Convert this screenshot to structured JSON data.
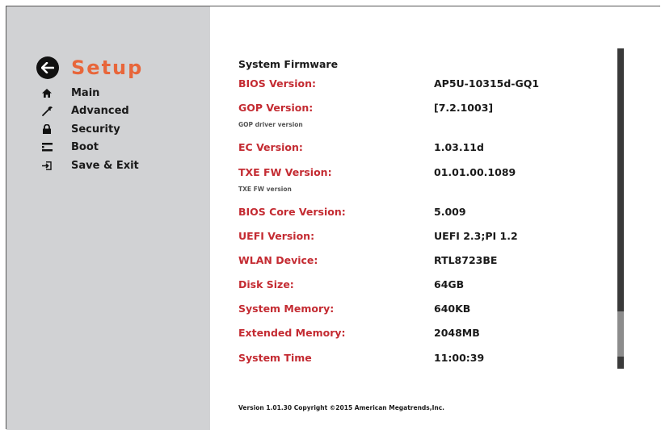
{
  "header": {
    "title": "Setup"
  },
  "nav": [
    {
      "label": "Main",
      "icon": "home-icon"
    },
    {
      "label": "Advanced",
      "icon": "wrench-icon"
    },
    {
      "label": "Security",
      "icon": "lock-icon"
    },
    {
      "label": "Boot",
      "icon": "boot-drive-icon"
    },
    {
      "label": "Save & Exit",
      "icon": "exit-icon"
    }
  ],
  "section_title": "System Firmware",
  "rows": [
    {
      "label": "BIOS Version:",
      "value": "AP5U-10315d-GQ1"
    },
    {
      "label": "GOP  Version:",
      "value": "[7.2.1003]",
      "help": "GOP driver version"
    },
    {
      "label": "EC  Version:",
      "value": "1.03.11d"
    },
    {
      "label": "TXE FW Version:",
      "value": "01.01.00.1089",
      "help": "TXE FW version"
    },
    {
      "label": "BIOS Core Version:",
      "value": "5.009"
    },
    {
      "label": "UEFI Version:",
      "value": "UEFI 2.3;PI 1.2"
    },
    {
      "label": "WLAN Device:",
      "value": "RTL8723BE"
    },
    {
      "label": "Disk Size:",
      "value": "64GB"
    },
    {
      "label": "System Memory:",
      "value": "640KB"
    },
    {
      "label": "Extended Memory:",
      "value": "2048MB"
    },
    {
      "label": "System Time",
      "value": "11:00:39"
    }
  ],
  "footer": "Version 1.01.30 Copyright ©2015 American Megatrends,Inc.",
  "colors": {
    "accent": "#e8663a",
    "label_red": "#c42b32",
    "sidebar_bg": "#d1d2d4"
  }
}
